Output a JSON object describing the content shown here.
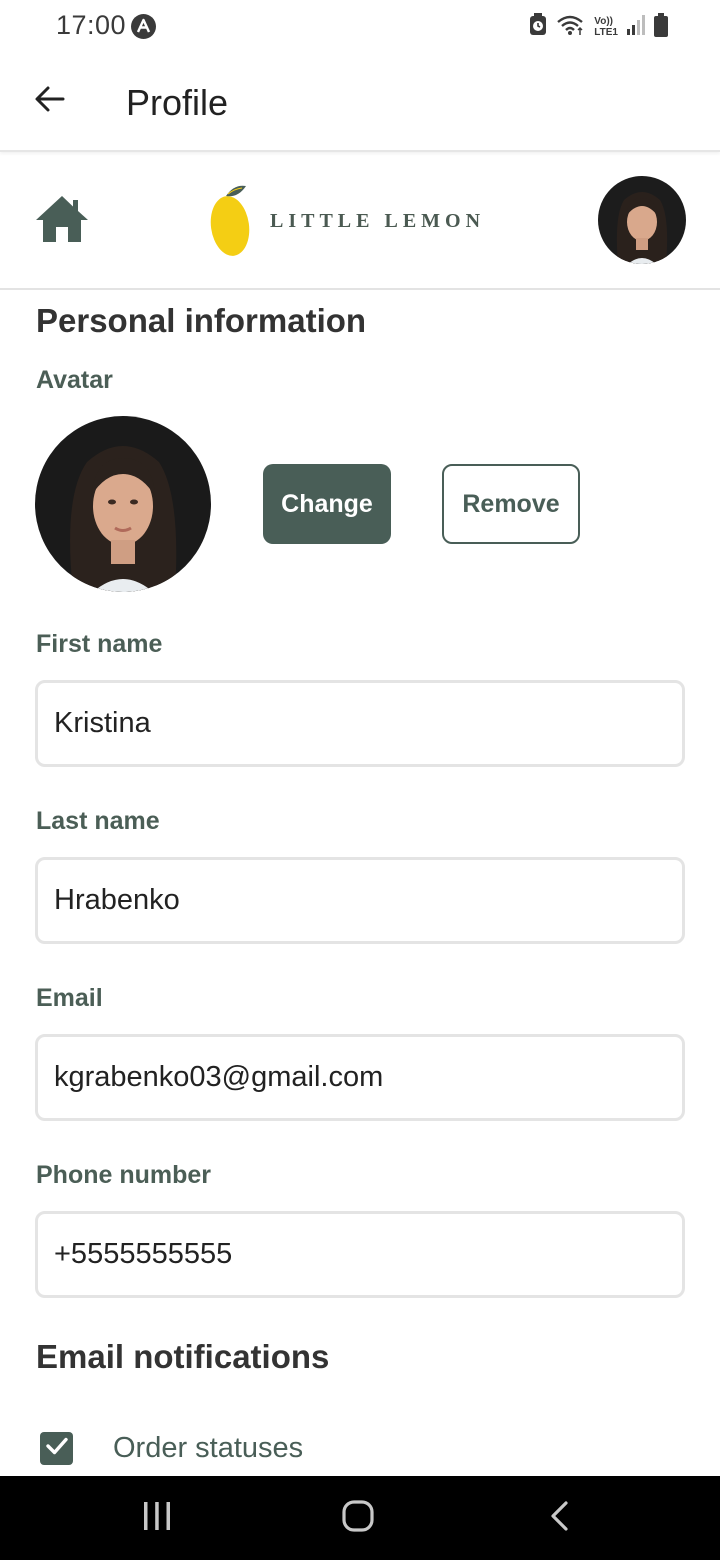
{
  "status_bar": {
    "time": "17:00",
    "icons": [
      "a-notification-icon",
      "alarm-icon",
      "wifi-icon",
      "volte-lte-icon",
      "signal-icon",
      "battery-icon"
    ],
    "volte_label": "Vo))",
    "lte_label": "LTE1"
  },
  "app_bar": {
    "title": "Profile",
    "back_icon": "arrow-left-icon"
  },
  "header": {
    "home_icon": "home-icon",
    "logo_text": "LITTLE LEMON",
    "avatar_alt": "Profile photo"
  },
  "personal_info": {
    "title": "Personal information",
    "avatar_label": "Avatar",
    "change_label": "Change",
    "remove_label": "Remove",
    "fields": [
      {
        "label": "First name",
        "value": "Kristina"
      },
      {
        "label": "Last name",
        "value": "Hrabenko"
      },
      {
        "label": "Email",
        "value": "kgrabenko03@gmail.com"
      },
      {
        "label": "Phone number",
        "value": "+5555555555"
      }
    ]
  },
  "email_notifications": {
    "title": "Email notifications",
    "options": [
      {
        "label": "Order statuses",
        "checked": true
      }
    ]
  },
  "nav_bar": {
    "icons": [
      "recents-icon",
      "home-circle-icon",
      "back-chevron-icon"
    ]
  },
  "colors": {
    "primary": "#495e57",
    "label": "#4b5e56",
    "lemon": "#f4ce14",
    "border": "#e4e4e4"
  }
}
